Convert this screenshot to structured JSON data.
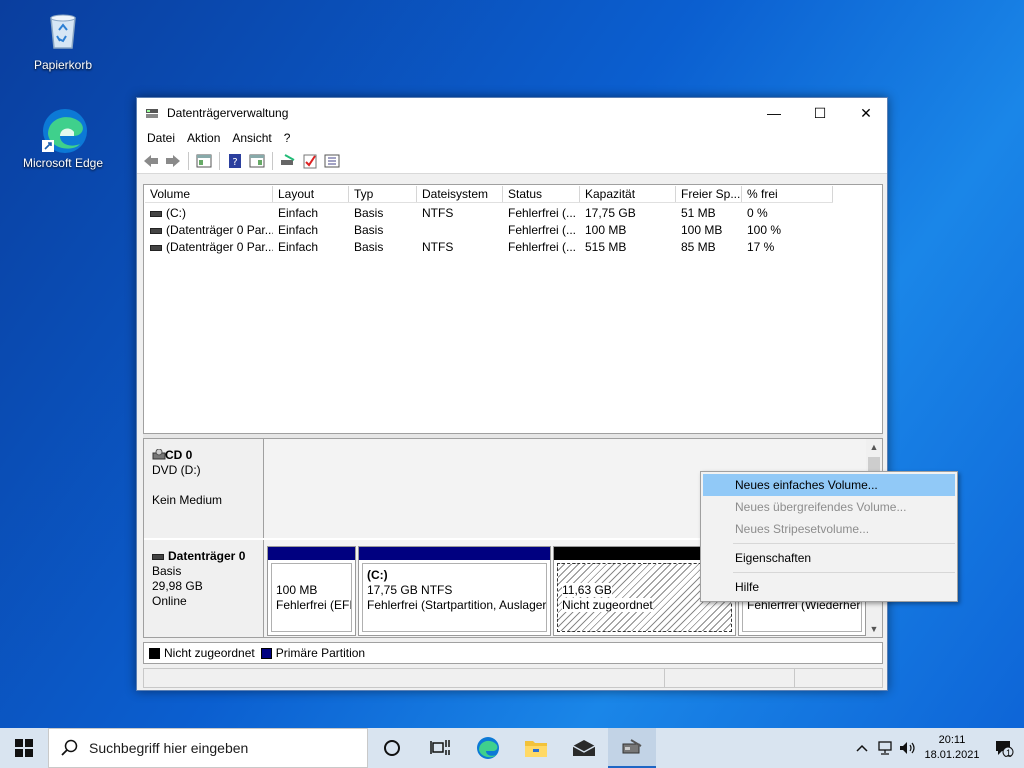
{
  "desktop": {
    "icons": [
      {
        "label": "Papierkorb"
      },
      {
        "label": "Microsoft Edge"
      }
    ]
  },
  "window": {
    "title": "Datenträgerverwaltung",
    "controls": {
      "minimize": "—",
      "maximize": "☐",
      "close": "✕"
    },
    "menu": [
      "Datei",
      "Aktion",
      "Ansicht",
      "?"
    ],
    "volume_list": {
      "columns": [
        "Volume",
        "Layout",
        "Typ",
        "Dateisystem",
        "Status",
        "Kapazität",
        "Freier Sp...",
        "% frei"
      ],
      "rows": [
        [
          "(C:)",
          "Einfach",
          "Basis",
          "NTFS",
          "Fehlerfrei (...",
          "17,75 GB",
          "51 MB",
          "0 %"
        ],
        [
          "(Datenträger 0 Par...",
          "Einfach",
          "Basis",
          "",
          "Fehlerfrei (...",
          "100 MB",
          "100 MB",
          "100 %"
        ],
        [
          "(Datenträger 0 Par...",
          "Einfach",
          "Basis",
          "NTFS",
          "Fehlerfrei (...",
          "515 MB",
          "85 MB",
          "17 %"
        ]
      ]
    },
    "disks": [
      {
        "name": "CD 0",
        "type": "DVD (D:)",
        "media": "Kein Medium"
      },
      {
        "name": "Datenträger 0",
        "type": "Basis",
        "size": "29,98 GB",
        "status": "Online",
        "partitions": [
          {
            "title": "",
            "line1": "100 MB",
            "line2": "Fehlerfrei (EFI-"
          },
          {
            "title": "(C:)",
            "line1": "17,75 GB NTFS",
            "line2": "Fehlerfrei (Startpartition, Auslager"
          },
          {
            "title": "",
            "line1": "11,63 GB",
            "line2": "Nicht zugeordnet"
          },
          {
            "title": "",
            "line1": "",
            "line2": "Fehlerfrei (Wiederher"
          }
        ]
      }
    ],
    "legend": {
      "unallocated": "Nicht zugeordnet",
      "primary": "Primäre Partition"
    }
  },
  "context_menu": {
    "items": [
      {
        "label": "Neues einfaches Volume...",
        "state": "highlighted"
      },
      {
        "label": "Neues übergreifendes Volume...",
        "state": "disabled"
      },
      {
        "label": "Neues Stripesetvolume...",
        "state": "disabled"
      },
      {
        "label": "Eigenschaften",
        "state": "normal"
      },
      {
        "label": "Hilfe",
        "state": "normal"
      }
    ]
  },
  "taskbar": {
    "search_placeholder": "Suchbegriff hier eingeben",
    "clock_time": "20:11",
    "clock_date": "18.01.2021",
    "notification_count": "1"
  },
  "colors": {
    "primary_partition": "#000080",
    "unallocated": "#000000",
    "highlight": "#91c9f7"
  }
}
